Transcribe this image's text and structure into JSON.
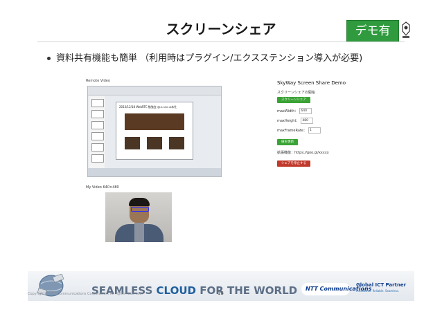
{
  "slide": {
    "title": "スクリーンシェア",
    "demo_badge": "デモ有",
    "bullet": "資料共有機能も簡単 （利用時はプラグイン/エクスステンション導入が必要)",
    "page_number": "13",
    "copyright": "Copyright© NTT Communications Corporation. All rights reserved."
  },
  "left_panel": {
    "screen_label": "Remote Video",
    "ppt_slide_title": "2013/12/18 WebRTC 勉強会 @ニコニコ本社",
    "camera_label": "My Video 640×480"
  },
  "right_panel": {
    "title": "SkyWay Screen Share Demo",
    "share_prompt": "スクリーンシェアの開始",
    "share_button": "スクリーンシェア",
    "max_width_label": "maxWidth：",
    "max_width_value": "640",
    "max_height_label": "maxHeight：",
    "max_height_value": "480",
    "max_frame_label": "maxFrameRate：",
    "max_frame_value": "1",
    "apply_button": "値を更新",
    "extension_label": "拡張機能：https://goo.gl/xxxxx",
    "stop_button": "シェアを停止する"
  },
  "footer": {
    "tagline_1": "SEAMLESS ",
    "tagline_cloud": "CLOUD",
    "tagline_2": " FOR THE WORLD",
    "ntt_logo": "NTT Communications",
    "gict_1": "Global ICT Partner",
    "gict_2": "Innovative. Reliable. Seamless."
  },
  "colors": {
    "badge": "#2f9a3e",
    "footer_text": "#5d6f86",
    "cloud": "#1f5f9e",
    "ntt_blue": "#0d3c8c"
  }
}
